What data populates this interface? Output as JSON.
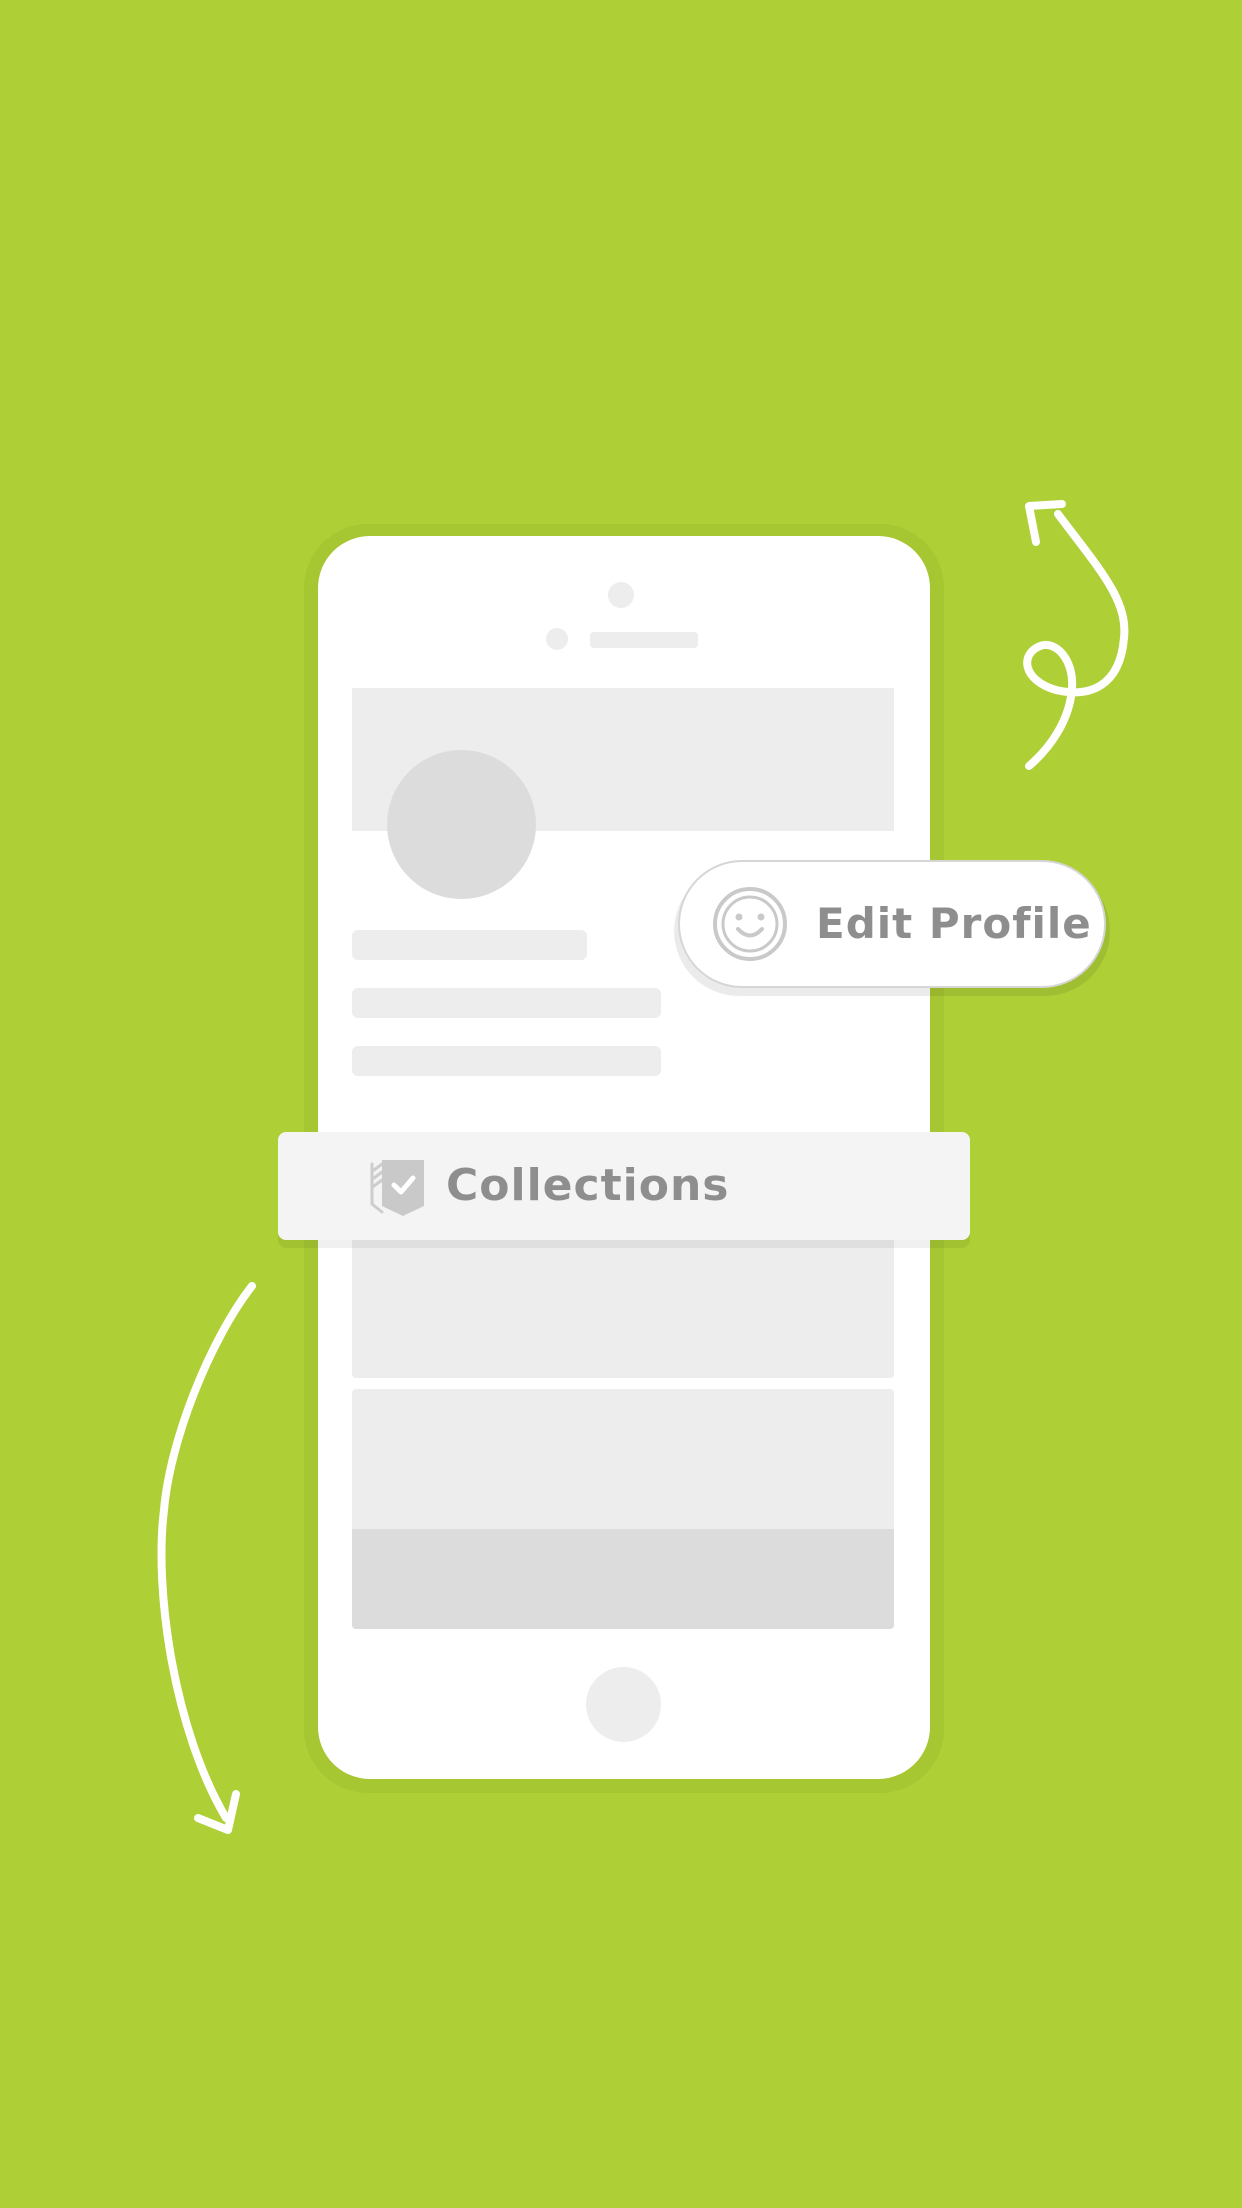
{
  "colors": {
    "background": "#AECF36",
    "screen": "#FFFFFF",
    "placeholder_light": "#EDEDED",
    "placeholder_dark": "#DCDCDC",
    "label_text": "#8E8E8E",
    "arrow": "#FFFFFF"
  },
  "edit_profile": {
    "label": "Edit Profile",
    "icon": "smiley-face-icon"
  },
  "collections": {
    "label": "Collections",
    "icon": "bookmark-check-icon"
  },
  "decorations": {
    "top_right": "curly-arrow-up-icon",
    "bottom_left": "curved-arrow-down-icon"
  }
}
